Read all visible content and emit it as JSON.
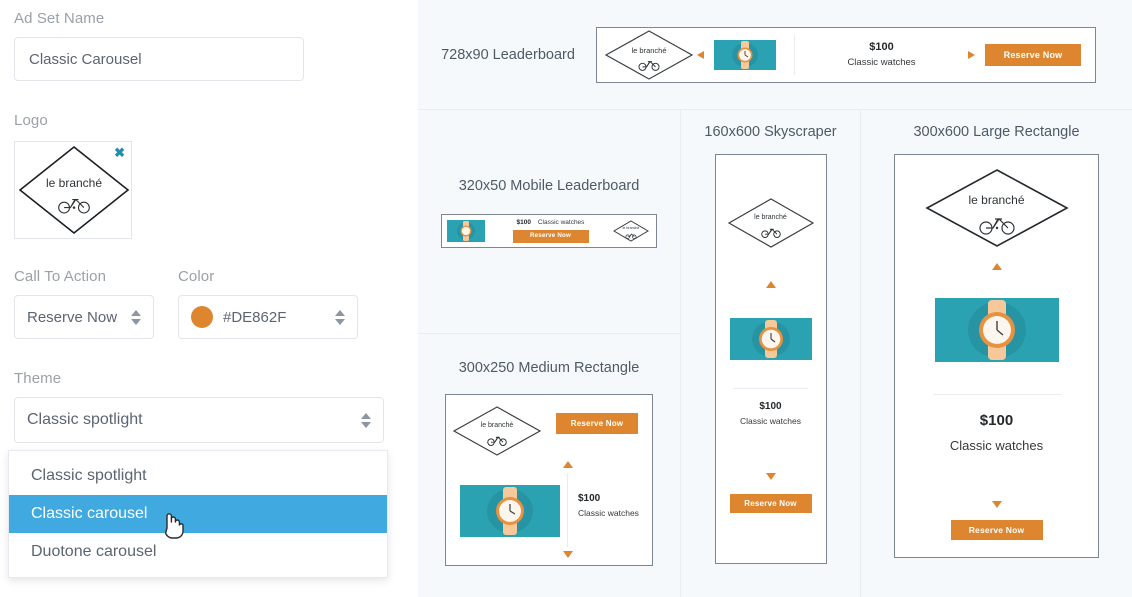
{
  "form": {
    "ad_set_name": {
      "label": "Ad Set Name",
      "value": "Classic Carousel"
    },
    "logo": {
      "label": "Logo",
      "remove_icon": "close-icon",
      "brand_text": "le branché"
    },
    "call_to_action": {
      "label": "Call To Action",
      "value": "Reserve Now"
    },
    "color": {
      "label": "Color",
      "value": "#DE862F",
      "swatch": "#DE862F"
    },
    "theme": {
      "label": "Theme",
      "value": "Classic spotlight",
      "options": [
        {
          "label": "Classic spotlight",
          "selected": false
        },
        {
          "label": "Classic carousel",
          "selected": true
        },
        {
          "label": "Duotone carousel",
          "selected": false
        }
      ]
    }
  },
  "previews": {
    "leaderboard_728x90": {
      "title": "728x90 Leaderboard",
      "brand_text": "le branché",
      "price": "$100",
      "product": "Classic watches",
      "cta": "Reserve Now"
    },
    "mobile_320x50": {
      "title": "320x50 Mobile Leaderboard",
      "brand_text": "le branché",
      "price": "$100",
      "product": "Classic watches",
      "cta": "Reserve Now"
    },
    "medium_300x250": {
      "title": "300x250 Medium Rectangle",
      "brand_text": "le branché",
      "price": "$100",
      "product": "Classic watches",
      "cta": "Reserve Now"
    },
    "skyscraper_160x600": {
      "title": "160x600 Skyscraper",
      "brand_text": "le branché",
      "price": "$100",
      "product": "Classic watches",
      "cta": "Reserve Now"
    },
    "large_300x600": {
      "title": "300x600 Large Rectangle",
      "brand_text": "le branché",
      "price": "$100",
      "product": "Classic watches",
      "cta": "Reserve Now"
    }
  },
  "colors": {
    "accent_orange": "#DE862F",
    "teal": "#2BA2B2",
    "highlight_blue": "#3FA9E0",
    "panel_bg": "#F6F9FC",
    "close_icon": "#1F8FB5"
  }
}
